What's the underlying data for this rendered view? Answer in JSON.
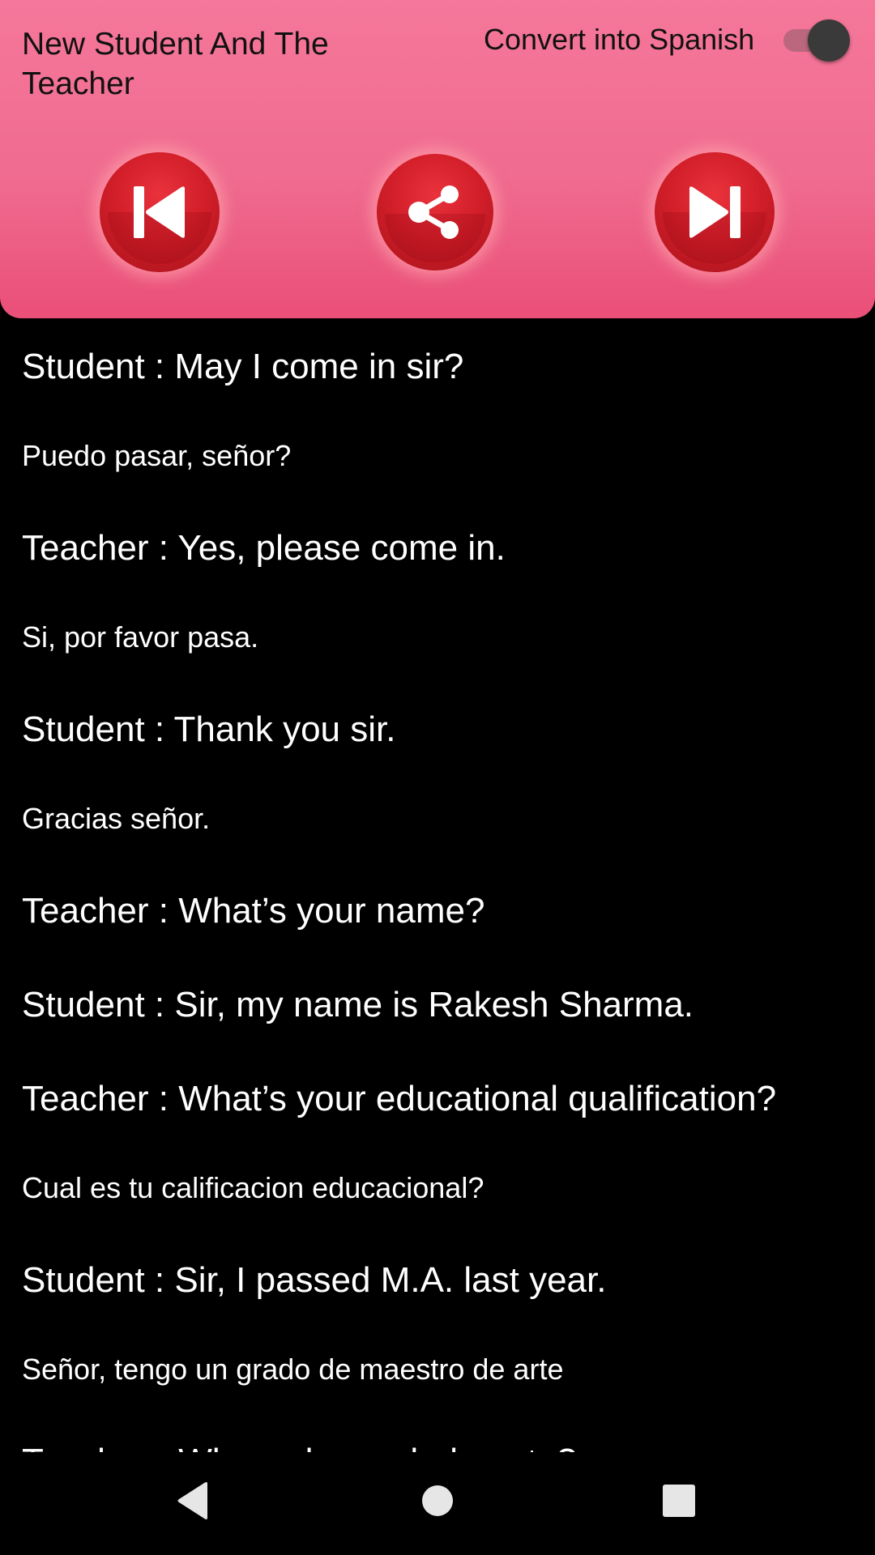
{
  "header": {
    "title": "New Student And The Teacher",
    "toggle_label": "Convert into Spanish",
    "toggle_on": true,
    "background_color": "#f06c90",
    "buttons": [
      {
        "name": "previous",
        "icon": "skip-previous-icon"
      },
      {
        "name": "share",
        "icon": "share-icon"
      },
      {
        "name": "next",
        "icon": "skip-next-icon"
      }
    ]
  },
  "dialogue": [
    {
      "text": "Student : May I come in sir?",
      "lang": "en"
    },
    {
      "text": "Puedo pasar, señor?",
      "lang": "es"
    },
    {
      "text": "Teacher : Yes, please come in.",
      "lang": "en"
    },
    {
      "text": "Si, por favor pasa.",
      "lang": "es"
    },
    {
      "text": "Student : Thank you sir.",
      "lang": "en"
    },
    {
      "text": "Gracias señor.",
      "lang": "es"
    },
    {
      "text": "Teacher : What’s your name?",
      "lang": "en"
    },
    {
      "text": "Student : Sir,  my name is Rakesh Sharma.",
      "lang": "en"
    },
    {
      "text": "Teacher : What’s your educational qualification?",
      "lang": "en"
    },
    {
      "text": "Cual es tu calificacion educacional?",
      "lang": "es"
    },
    {
      "text": "Student : Sir, I passed M.A. last year.",
      "lang": "en"
    },
    {
      "text": "Señor, tengo un grado de maestro de arte",
      "lang": "es"
    },
    {
      "text": "Teacher : Where do you belong to?",
      "lang": "en"
    }
  ],
  "navbar": {
    "buttons": [
      "back-icon",
      "home-icon",
      "recents-icon"
    ]
  }
}
